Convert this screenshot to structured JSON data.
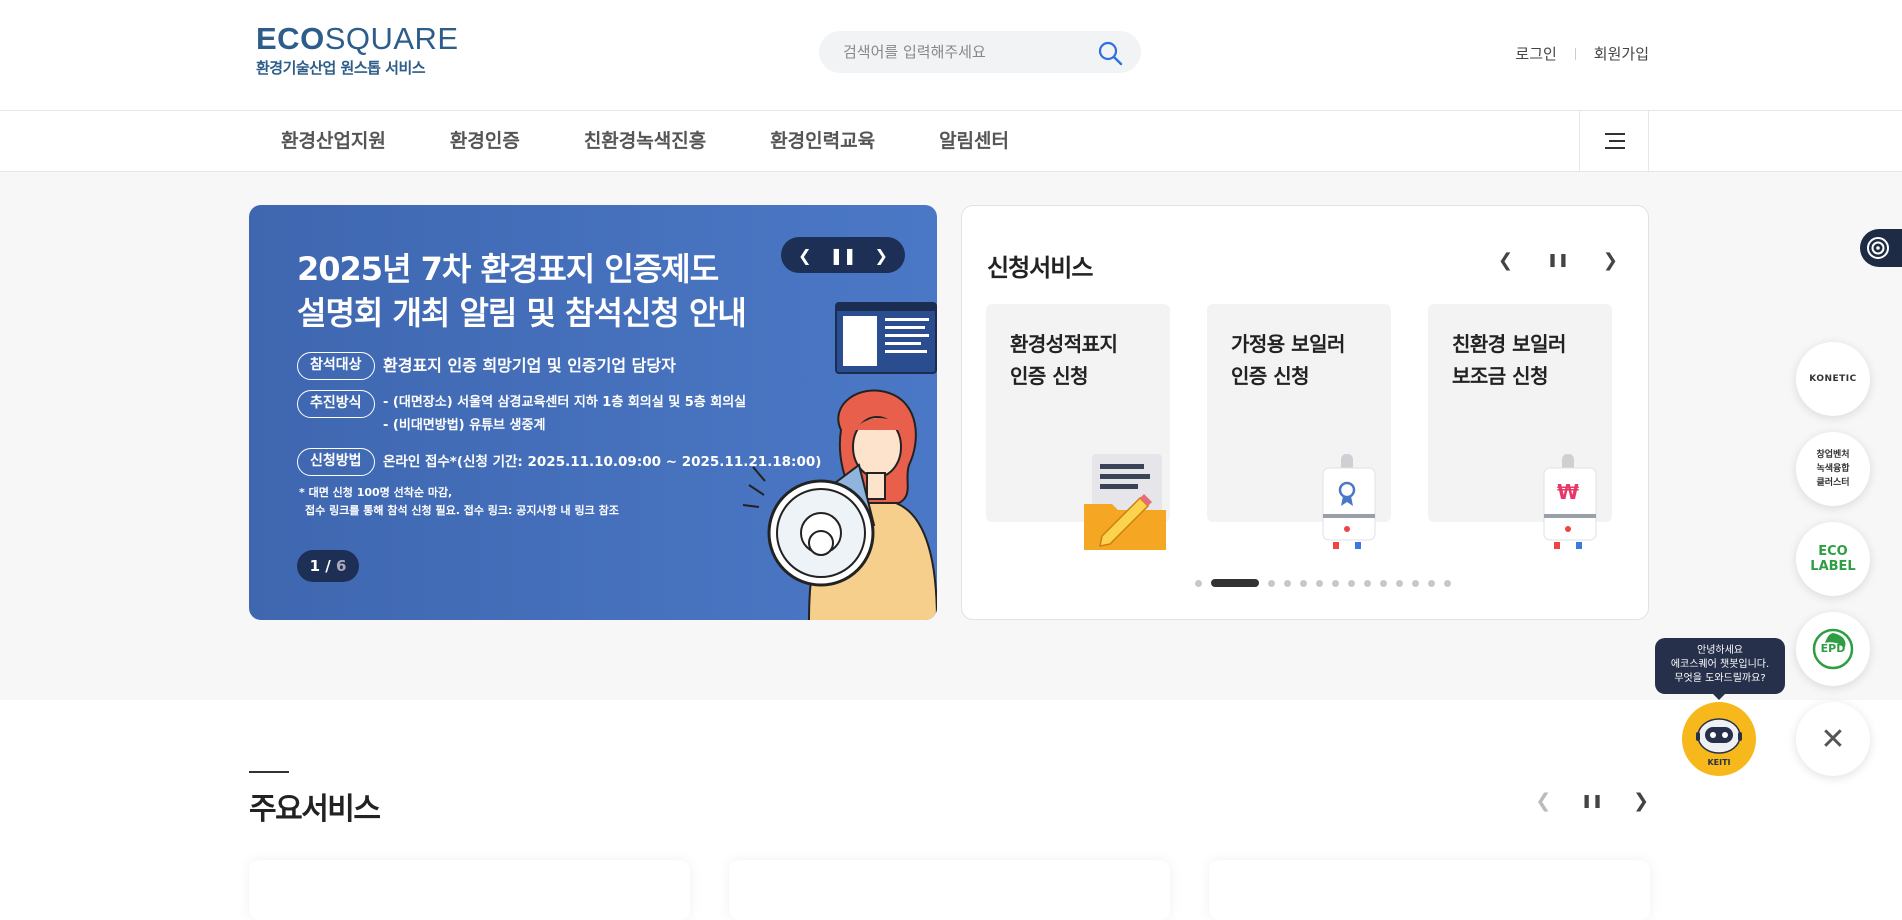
{
  "header": {
    "logo_main_bold": "ECO",
    "logo_main_light": "SQUARE",
    "logo_sub": "환경기술산업 원스톱 서비스",
    "search_placeholder": "검색어를 입력해주세요",
    "login": "로그인",
    "join": "회원가입"
  },
  "gnb": {
    "items": [
      "환경산업지원",
      "환경인증",
      "친환경녹색진흥",
      "환경인력교육",
      "알림센터"
    ]
  },
  "banner": {
    "title_line1": "2025년 7차 환경표지 인증제도",
    "title_line2": "설명회 개최 알림 및 참석신청 안내",
    "label_target": "참석대상",
    "text_target": "환경표지 인증 희망기업 및 인증기업 담당자",
    "label_method": "추진방식",
    "text_method1": "- (대면장소) 서울역 삼경교육센터 지하 1층 회의실 및 5층 회의실",
    "text_method2": "- (비대면방법) 유튜브 생중계",
    "label_apply": "신청방법",
    "text_apply": "온라인 접수*(신청 기간: 2025.11.10.09:00 ~ 2025.11.21.18:00)",
    "note1": "* 대면 신청 100명 선착순 마감,",
    "note2": "접수 링크를 통해 참석 신청 필요. 접수 링크: 공지사항 내 링크 참조",
    "pager_current": "1",
    "pager_sep": " / ",
    "pager_total": "6"
  },
  "apply": {
    "title": "신청서비스",
    "cards": [
      {
        "line1": "환경성적표지",
        "line2": "인증 신청"
      },
      {
        "line1": "가정용 보일러",
        "line2": "인증 신청"
      },
      {
        "line1": "친환경 보일러",
        "line2": "보조금 신청"
      }
    ],
    "dot_count": 14,
    "active_dot": 2
  },
  "main": {
    "title": "주요서비스"
  },
  "quick": {
    "konetic": "KONETIC",
    "cluster_line1": "창업벤처",
    "cluster_line2": "녹색융합",
    "cluster_line3": "클러스터",
    "eco_line1": "ECO",
    "eco_line2": "LABEL",
    "epd": "EPD"
  },
  "chatbot": {
    "line1": "안녕하세요",
    "line2": "에코스퀘어 챗봇입니다.",
    "line3": "무엇을 도와드릴까요?",
    "badge": "KEITI"
  },
  "colors": {
    "brand": "#2d5d8a",
    "banner": "#4470bb",
    "dark_control": "#1e2f56",
    "chatbot": "#f6b81b"
  }
}
